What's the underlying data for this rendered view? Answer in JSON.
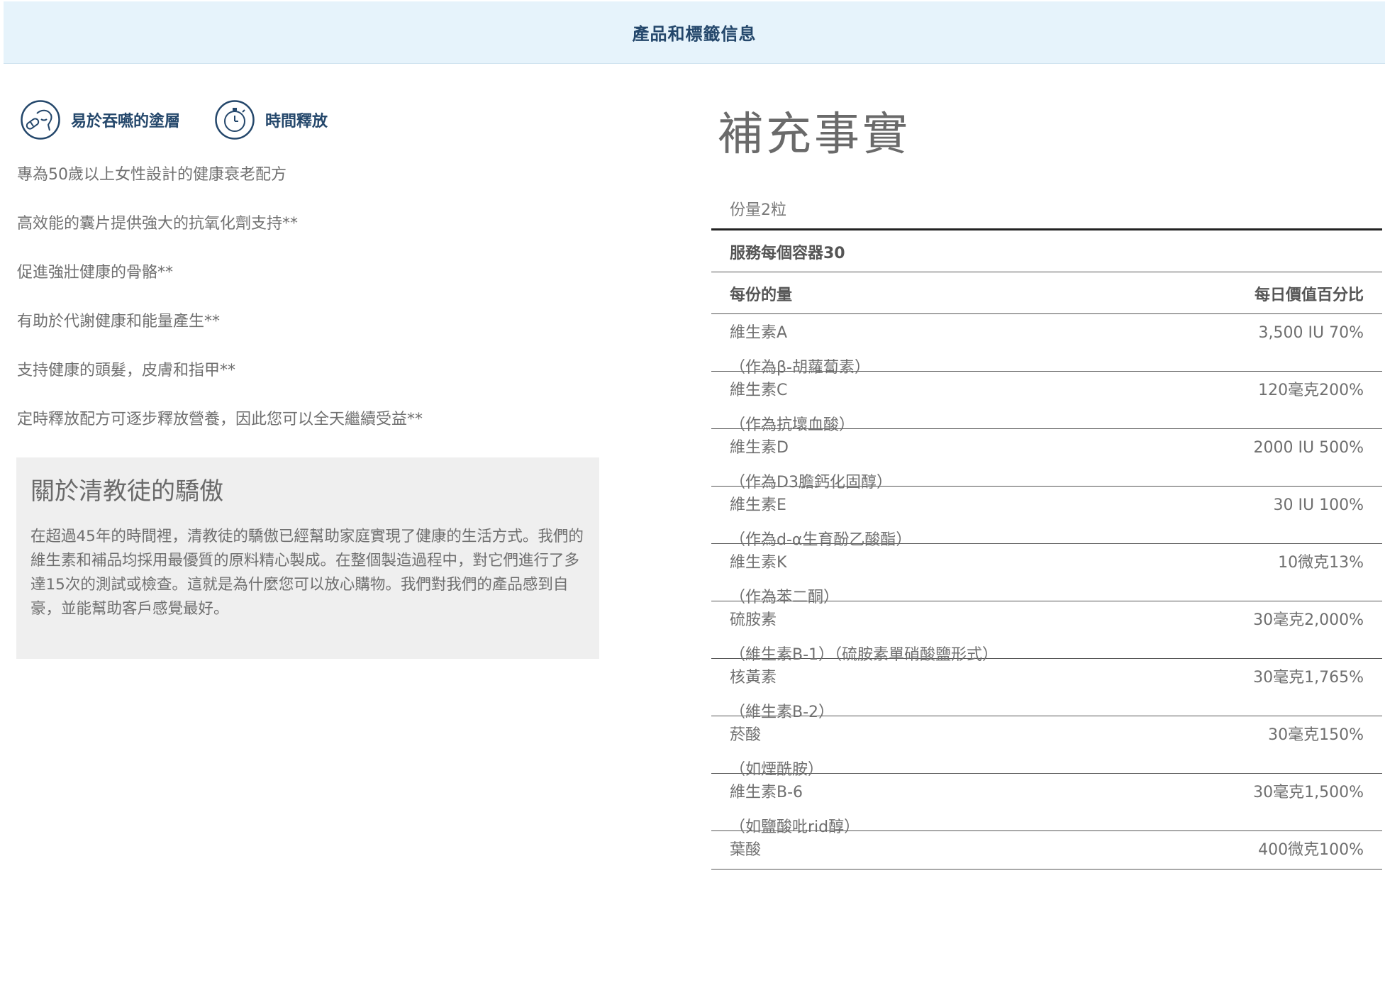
{
  "header": {
    "title": "產品和標籤信息"
  },
  "features": [
    {
      "icon": "capsule-swallow-icon",
      "label": "易於吞嚥的塗層"
    },
    {
      "icon": "stopwatch-icon",
      "label": "時間釋放"
    }
  ],
  "benefits": [
    "專為50歲以上女性設計的健康衰老配方",
    "高效能的囊片提供強大的抗氧化劑支持**",
    "促進強壯健康的骨骼**",
    "有助於代謝健康和能量產生**",
    "支持健康的頭髮，皮膚和指甲**",
    "定時釋放配方可逐步釋放營養，因此您可以全天繼續受益**"
  ],
  "about": {
    "title": "關於清教徒的驕傲",
    "body": "在超過45年的時間裡，清教徒的驕傲已經幫助家庭實現了健康的生活方式。我們的維生素和補品均採用最優質的原料精心製成。在整個製造過程中，對它們進行了多達15次的測試或檢查。這就是為什麼您可以放心購物。我們對我們的產品感到自豪，並能幫助客戶感覺最好。"
  },
  "facts": {
    "title": "補充事實",
    "serving_size": "份量2粒",
    "servings_per_container": "服務每個容器30",
    "col_amount": "每份的量",
    "col_dv": "每日價值百分比",
    "nutrients": [
      {
        "name": "維生素A",
        "value": "3,500 IU 70%",
        "note": "（作為β-胡蘿蔔素）"
      },
      {
        "name": "維生素C",
        "value": "120毫克200%",
        "note": "（作為抗壞血酸）"
      },
      {
        "name": "維生素D",
        "value": "2000 IU 500%",
        "note": "（作為D3膽鈣化固醇）"
      },
      {
        "name": "維生素E",
        "value": "30 IU 100%",
        "note": "（作為d-α生育酚乙酸酯）"
      },
      {
        "name": "維生素K",
        "value": "10微克13%",
        "note": "（作為苯二酮）"
      },
      {
        "name": "硫胺素",
        "value": "30毫克2,000%",
        "note": "（維生素B-1）（硫胺素單硝酸鹽形式）"
      },
      {
        "name": "核黃素",
        "value": "30毫克1,765%",
        "note": "（維生素B-2）"
      },
      {
        "name": "菸酸",
        "value": "30毫克150%",
        "note": "（如煙酰胺）"
      },
      {
        "name": "維生素B-6",
        "value": "30毫克1,500%",
        "note": "（如鹽酸吡rid醇）"
      },
      {
        "name": "葉酸",
        "value": "400微克100%",
        "note": ""
      }
    ]
  },
  "colors": {
    "header_bg": "#e6f3fb",
    "brand_navy": "#24476b",
    "panel_bg": "#efefef"
  }
}
